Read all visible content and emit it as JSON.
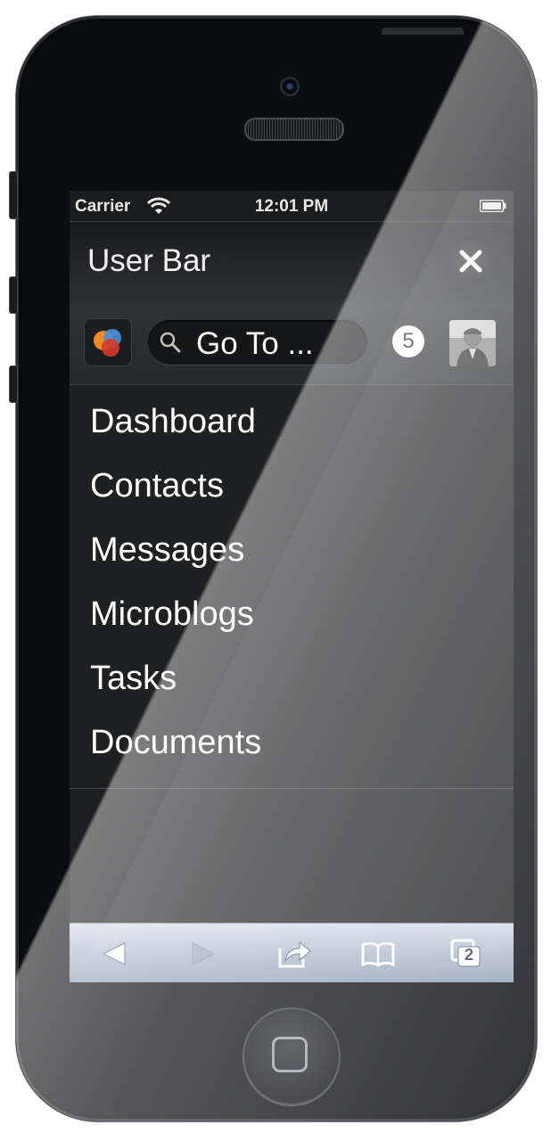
{
  "status_bar": {
    "carrier": "Carrier",
    "time": "12:01 PM"
  },
  "header": {
    "title": "User Bar",
    "close_icon": "close-icon"
  },
  "toolbar": {
    "logo_icon": "app-logo-icon",
    "search_placeholder": "Go To ...",
    "notification_count": "5",
    "avatar": "user-avatar"
  },
  "menu": {
    "items": [
      {
        "label": "Dashboard"
      },
      {
        "label": "Contacts"
      },
      {
        "label": "Messages"
      },
      {
        "label": "Microblogs"
      },
      {
        "label": "Tasks"
      },
      {
        "label": "Documents"
      }
    ]
  },
  "browser_toolbar": {
    "icons": [
      "back-icon",
      "forward-icon",
      "share-icon",
      "bookmarks-icon",
      "tabs-icon"
    ],
    "tab_count": "2"
  },
  "colors": {
    "screen_background": "#1e1f21",
    "menu_text": "#ffffff",
    "safari_bar": "#a8b6c9",
    "badge_background": "#ffffff"
  }
}
